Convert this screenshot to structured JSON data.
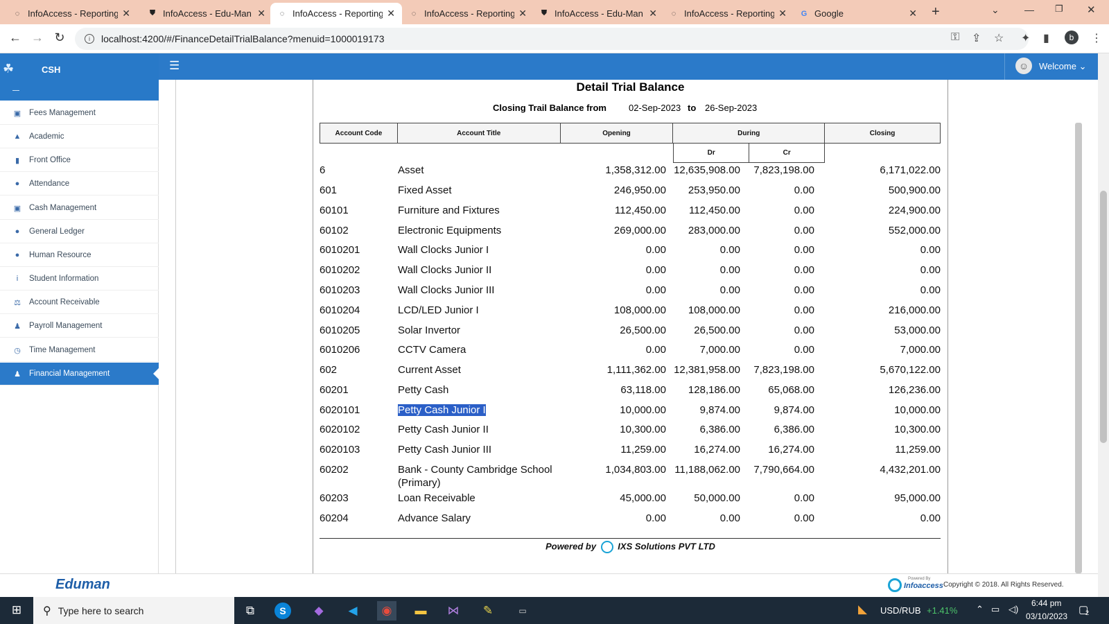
{
  "browser": {
    "tabs": [
      {
        "title": "InfoAccess - Reporting",
        "icon": "chrome-globe-icon",
        "active": false
      },
      {
        "title": "InfoAccess - Edu-Man",
        "icon": "shield-icon",
        "active": false
      },
      {
        "title": "InfoAccess - Reporting",
        "icon": "chrome-globe-icon",
        "active": true
      },
      {
        "title": "InfoAccess - Reporting",
        "icon": "chrome-globe-icon",
        "active": false
      },
      {
        "title": "InfoAccess - Edu-Man",
        "icon": "shield-icon",
        "active": false
      },
      {
        "title": "InfoAccess - Reporting",
        "icon": "chrome-globe-icon",
        "active": false
      },
      {
        "title": "Google",
        "icon": "google-icon",
        "active": false
      }
    ],
    "url": "localhost:4200/#/FinanceDetailTrialBalance?menuid=1000019173",
    "profile_initial": "b"
  },
  "app": {
    "brand": "CSH",
    "welcome": "Welcome",
    "footer_logo": "Eduman",
    "copyright": "Copyright © 2018. All Rights Reserved.",
    "footer_brand": "Infoaccess",
    "footer_brand_small": "Powered By"
  },
  "sidebar": {
    "items": [
      {
        "label": "Fees Management",
        "icon": "money-icon"
      },
      {
        "label": "Academic",
        "icon": "graduation-cap-icon"
      },
      {
        "label": "Front Office",
        "icon": "info-box-icon"
      },
      {
        "label": "Attendance",
        "icon": "users-icon"
      },
      {
        "label": "Cash Management",
        "icon": "money-icon"
      },
      {
        "label": "General Ledger",
        "icon": "users-icon"
      },
      {
        "label": "Human Resource",
        "icon": "users-icon"
      },
      {
        "label": "Student Information",
        "icon": "info-icon"
      },
      {
        "label": "Account Receivable",
        "icon": "balance-scale-icon"
      },
      {
        "label": "Payroll Management",
        "icon": "user-money-icon"
      },
      {
        "label": "Time Management",
        "icon": "clock-icon"
      },
      {
        "label": "Financial Management",
        "icon": "user-icon",
        "active": true
      }
    ]
  },
  "report": {
    "title": "Detail Trial Balance",
    "subtitle_label": "Closing Trail Balance from",
    "from_date": "02-Sep-2023",
    "to_label": "to",
    "to_date": "26-Sep-2023",
    "headers": {
      "code": "Account Code",
      "title": "Account Title",
      "opening": "Opening",
      "during": "During",
      "dr": "Dr",
      "cr": "Cr",
      "closing": "Closing"
    },
    "rows": [
      {
        "code": "6",
        "title": "Asset",
        "opening": "1,358,312.00",
        "dr": "12,635,908.00",
        "cr": "7,823,198.00",
        "closing": "6,171,022.00"
      },
      {
        "code": "601",
        "title": "Fixed Asset",
        "opening": "246,950.00",
        "dr": "253,950.00",
        "cr": "0.00",
        "closing": "500,900.00"
      },
      {
        "code": "60101",
        "title": "Furniture and Fixtures",
        "opening": "112,450.00",
        "dr": "112,450.00",
        "cr": "0.00",
        "closing": "224,900.00"
      },
      {
        "code": "60102",
        "title": "Electronic Equipments",
        "opening": "269,000.00",
        "dr": "283,000.00",
        "cr": "0.00",
        "closing": "552,000.00"
      },
      {
        "code": "6010201",
        "title": "Wall Clocks Junior I",
        "opening": "0.00",
        "dr": "0.00",
        "cr": "0.00",
        "closing": "0.00"
      },
      {
        "code": "6010202",
        "title": "Wall Clocks Junior II",
        "opening": "0.00",
        "dr": "0.00",
        "cr": "0.00",
        "closing": "0.00"
      },
      {
        "code": "6010203",
        "title": "Wall Clocks Junior III",
        "opening": "0.00",
        "dr": "0.00",
        "cr": "0.00",
        "closing": "0.00"
      },
      {
        "code": "6010204",
        "title": "LCD/LED Junior I",
        "opening": "108,000.00",
        "dr": "108,000.00",
        "cr": "0.00",
        "closing": "216,000.00"
      },
      {
        "code": "6010205",
        "title": "Solar Invertor",
        "opening": "26,500.00",
        "dr": "26,500.00",
        "cr": "0.00",
        "closing": "53,000.00"
      },
      {
        "code": "6010206",
        "title": "CCTV Camera",
        "opening": "0.00",
        "dr": "7,000.00",
        "cr": "0.00",
        "closing": "7,000.00"
      },
      {
        "code": "602",
        "title": "Current Asset",
        "opening": "1,111,362.00",
        "dr": "12,381,958.00",
        "cr": "7,823,198.00",
        "closing": "5,670,122.00"
      },
      {
        "code": "60201",
        "title": "Petty Cash",
        "opening": "63,118.00",
        "dr": "128,186.00",
        "cr": "65,068.00",
        "closing": "126,236.00"
      },
      {
        "code": "6020101",
        "title": "Petty Cash Junior I",
        "opening": "10,000.00",
        "dr": "9,874.00",
        "cr": "9,874.00",
        "closing": "10,000.00",
        "selected": true
      },
      {
        "code": "6020102",
        "title": "Petty Cash Junior II",
        "opening": "10,300.00",
        "dr": "6,386.00",
        "cr": "6,386.00",
        "closing": "10,300.00"
      },
      {
        "code": "6020103",
        "title": "Petty Cash Junior III",
        "opening": "11,259.00",
        "dr": "16,274.00",
        "cr": "16,274.00",
        "closing": "11,259.00"
      },
      {
        "code": "60202",
        "title": "Bank - County Cambridge School",
        "title2": "(Primary)",
        "opening": "1,034,803.00",
        "dr": "11,188,062.00",
        "cr": "7,790,664.00",
        "closing": "4,432,201.00"
      },
      {
        "code": "60203",
        "title": "Loan Receivable",
        "opening": "45,000.00",
        "dr": "50,000.00",
        "cr": "0.00",
        "closing": "95,000.00"
      },
      {
        "code": "60204",
        "title": "Advance Salary",
        "opening": "0.00",
        "dr": "0.00",
        "cr": "0.00",
        "closing": "0.00"
      }
    ],
    "powered_by": "Powered by",
    "powered_company": "IXS Solutions PVT LTD"
  },
  "taskbar": {
    "search_placeholder": "Type here to search",
    "ticker": "USD/RUB",
    "ticker_change": "+1.41%",
    "time": "6:44 pm",
    "date": "03/10/2023",
    "notifications": "2"
  },
  "colors": {
    "primary": "#2b7ac9",
    "tabstrip": "#f3cbb8",
    "selection": "#2b5fc7",
    "ticker_up": "#4cc36a"
  }
}
